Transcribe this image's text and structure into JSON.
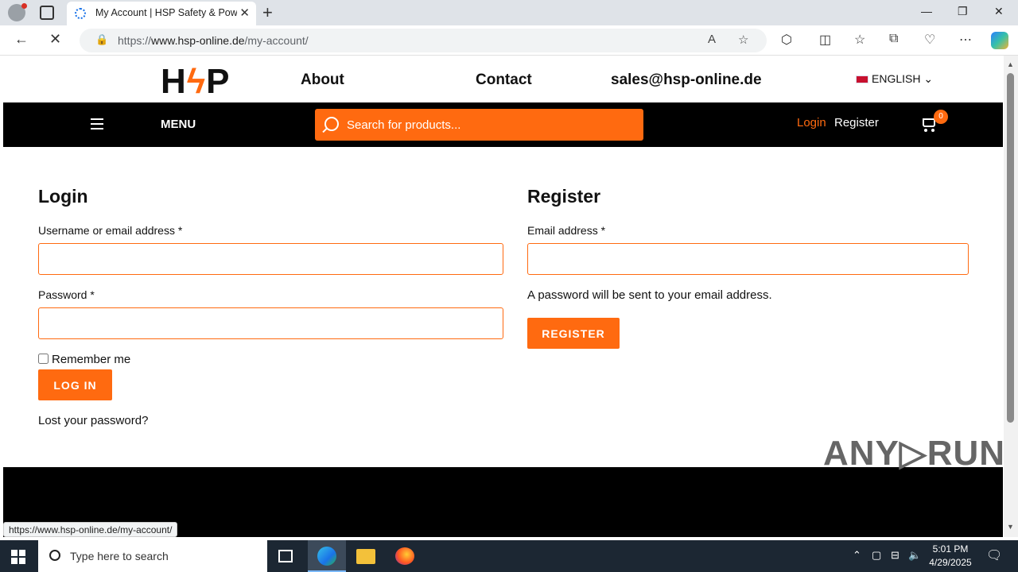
{
  "browser": {
    "tab_title": "My Account | HSP Safety & Pow",
    "url_prefix": "https://",
    "url_domain": "www.hsp-online.de",
    "url_path": "/my-account/",
    "status_url": "https://www.hsp-online.de/my-account/"
  },
  "site": {
    "logo_text_left": "H",
    "logo_bolt": "ϟ",
    "logo_text_right": "P",
    "top_nav": {
      "about": "About",
      "contact": "Contact",
      "email": "sales@hsp-online.de",
      "language": "ENGLISH"
    },
    "navbar": {
      "menu_label": "MENU",
      "search_placeholder": "Search for products...",
      "login": "Login",
      "register": "Register",
      "cart_count": "0"
    },
    "login": {
      "heading": "Login",
      "username_label": "Username or email address *",
      "password_label": "Password *",
      "remember_label": "Remember me",
      "button": "LOG IN",
      "lost_password": "Lost your password?"
    },
    "register": {
      "heading": "Register",
      "email_label": "Email address *",
      "note": "A password will be sent to your email address.",
      "button": "REGISTER"
    },
    "watermark": "ANY▷RUN"
  },
  "taskbar": {
    "search_placeholder": "Type here to search",
    "time": "5:01 PM",
    "date": "4/29/2025"
  }
}
